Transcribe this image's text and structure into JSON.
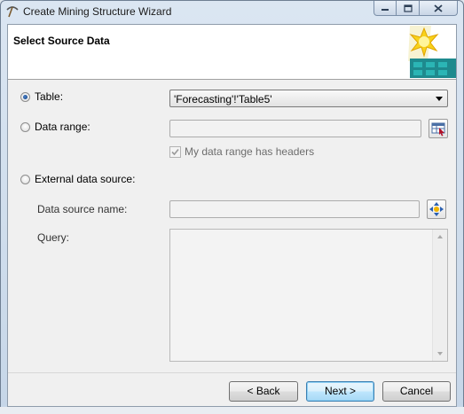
{
  "window": {
    "title": "Create Mining Structure Wizard",
    "buttons": {
      "minimize": "—",
      "maximize": "□",
      "close": "✕"
    }
  },
  "header": {
    "title": "Select Source Data",
    "image_icon": "mining-wizard-graphic"
  },
  "source_options": {
    "table": {
      "label": "Table:",
      "selected": true,
      "value": "'Forecasting'!'Table5'"
    },
    "data_range": {
      "label": "Data range:",
      "selected": false,
      "value": "",
      "headers_checkbox_label": "My data range has headers",
      "headers_checked": true,
      "enabled": false
    },
    "external": {
      "label": "External data source:",
      "selected": false,
      "source_name_label": "Data source name:",
      "source_name_value": "",
      "query_label": "Query:",
      "query_value": ""
    }
  },
  "footer": {
    "back_label": "< Back",
    "next_label": "Next >",
    "cancel_label": "Cancel"
  },
  "colors": {
    "accent": "#3c7fb1",
    "header_bg": "#ffffff",
    "body_bg": "#f0f0f0"
  }
}
